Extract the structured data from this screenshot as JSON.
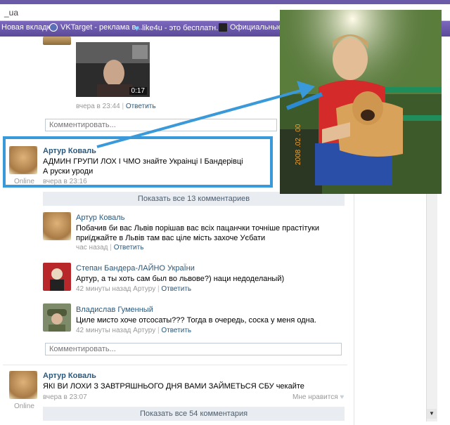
{
  "browser": {
    "address_text": "_ua",
    "bookmarks": [
      {
        "label": "Новая вкладка",
        "icon": "page-icon"
      },
      {
        "label": "VKTarget - реклама в...",
        "icon": "vktarget-icon"
      },
      {
        "label": "like4u - это бесплатн...",
        "icon": "heart-icon"
      },
      {
        "label": "Официальные нов",
        "icon": "news-icon"
      }
    ]
  },
  "post_top": {
    "video_duration": "0:17",
    "time": "вчера в 23:44",
    "reply": "Ответить",
    "comment_placeholder": "Комментировать..."
  },
  "post_main": {
    "author": "Артур Коваль",
    "line1": "АДМИН ГРУПИ ЛОХ І ЧМО знайте Украінці І Бандерівці",
    "line2": "А руски уроди",
    "status": "Online",
    "time": "вчера в 23:16",
    "show_all": "Показать все 13 комментариев"
  },
  "comments": [
    {
      "author": "Артур Коваль",
      "text": "Побачив би вас Львів порішав вас всіх пацанчки точніше прастітуки приїджайте в Львів там вас ціле мість захоче Уєбати",
      "time": "час назад",
      "reply": "Ответить"
    },
    {
      "author": "Степан Бандера-ЛАЙНО УкраЇни",
      "text": "Артур, а ты хоть сам был во львове?) наци недоделаный)",
      "time": "42 минуты назад Артуру",
      "reply": "Ответить"
    },
    {
      "author": "Владислав Гуменный",
      "text": "Циле мисто хоче отсосаты??? Тогда в очередь, соска у меня одна.",
      "time": "42 минуты назад Артуру",
      "reply": "Ответить"
    }
  ],
  "comment_placeholder": "Комментировать...",
  "post_bottom": {
    "author": "Артур Коваль",
    "text": "ЯКІ ВИ ЛОХИ З ЗАВТРЯШНЬОГО ДНЯ ВАМИ ЗАЙМЕТЬСЯ СБУ чекайте",
    "status": "Online",
    "time": "вчера в 23:07",
    "like": "Мне нравится",
    "show_all": "Показать все 54 комментария"
  },
  "photo": {
    "date_stamp": "2008 .02 . 00"
  },
  "colors": {
    "link": "#2b587a",
    "highlight": "#3a9ad9",
    "browser_bar": "#6b5aa8"
  }
}
